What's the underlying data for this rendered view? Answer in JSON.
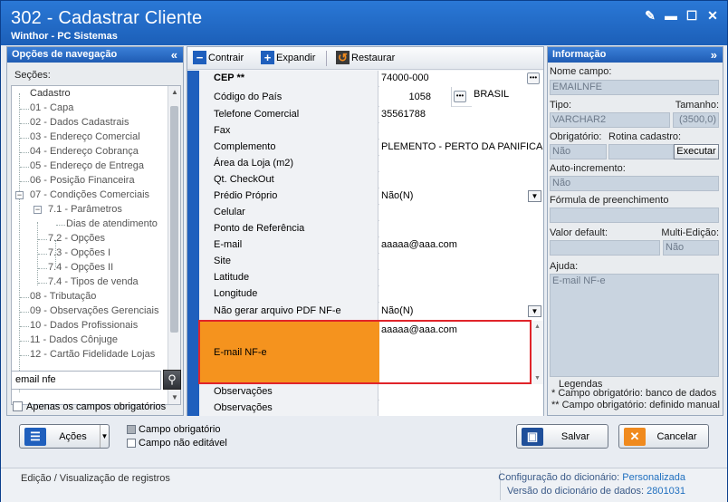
{
  "window": {
    "title": "302 - Cadastrar Cliente",
    "subtitle": "Winthor - PC Sistemas"
  },
  "nav": {
    "header": "Opções de navegação",
    "sections_label": "Seções:",
    "items": [
      {
        "label": "Cadastro"
      },
      {
        "label": "01 - Capa"
      },
      {
        "label": "02 - Dados Cadastrais"
      },
      {
        "label": "03 - Endereço Comercial"
      },
      {
        "label": "04 - Endereço Cobrança"
      },
      {
        "label": "05 - Endereço de Entrega"
      },
      {
        "label": "06 - Posição Financeira"
      },
      {
        "label": "07 - Condições Comerciais"
      },
      {
        "label": "7.1 - Parâmetros"
      },
      {
        "label": "Dias de atendimento"
      },
      {
        "label": "7.2 - Opções"
      },
      {
        "label": "7.3 - Opções I"
      },
      {
        "label": "7.4 - Opções II"
      },
      {
        "label": "7.4 - Tipos de venda"
      },
      {
        "label": "08 - Tributação"
      },
      {
        "label": "09 - Observações Gerenciais"
      },
      {
        "label": "10 - Dados Profissionais"
      },
      {
        "label": "11 - Dados Cônjuge"
      },
      {
        "label": "12 - Cartão Fidelidade Lojas"
      }
    ],
    "search_value": "email nfe",
    "only_required_label": "Apenas os campos obrigatórios"
  },
  "toolbar": {
    "collapse_label": "Contrair",
    "expand_label": "Expandir",
    "restore_label": "Restaurar"
  },
  "fields": [
    {
      "label": "CEP **",
      "value": "74000-000"
    },
    {
      "label": "Código do País",
      "value": "1058",
      "extra": "BRASIL"
    },
    {
      "label": "Telefone Comercial",
      "value": "35561788"
    },
    {
      "label": "Fax",
      "value": ""
    },
    {
      "label": "Complemento",
      "value": "PLEMENTO - PERTO DA PANIFICAI"
    },
    {
      "label": "Área da Loja (m2)",
      "value": ""
    },
    {
      "label": "Qt. CheckOut",
      "value": ""
    },
    {
      "label": "Prédio Próprio",
      "value": "Não(N)"
    },
    {
      "label": "Celular",
      "value": ""
    },
    {
      "label": "Ponto de Referência",
      "value": ""
    },
    {
      "label": "E-mail",
      "value": "aaaaa@aaa.com"
    },
    {
      "label": "Site",
      "value": ""
    },
    {
      "label": "Latitude",
      "value": ""
    },
    {
      "label": "Longitude",
      "value": ""
    },
    {
      "label": "Não gerar arquivo PDF NF-e",
      "value": "Não(N)"
    }
  ],
  "email_nfe": {
    "label": "E-mail NF-e",
    "value": "aaaaa@aaa.com"
  },
  "fields_after": [
    {
      "label": "Observações",
      "value": ""
    },
    {
      "label": "Observações",
      "value": ""
    }
  ],
  "info": {
    "header": "Informação",
    "field_name_label": "Nome campo:",
    "field_name": "EMAILNFE",
    "type_label": "Tipo:",
    "type": "VARCHAR2",
    "size_label": "Tamanho:",
    "size": "(3500,0)",
    "required_label": "Obrigatório:",
    "required": "Não",
    "routine_label": "Rotina cadastro:",
    "execute_label": "Executar",
    "autoinc_label": "Auto-incremento:",
    "autoinc": "Não",
    "formula_label": "Fórmula de preenchimento",
    "default_label": "Valor default:",
    "multiedit_label": "Multi-Edição:",
    "multiedit": "Não",
    "help_label": "Ajuda:",
    "help": "E-mail NF-e",
    "legend_title": "Legendas",
    "legend1": "* Campo obrigatório: banco de dados",
    "legend2": "** Campo obrigatório: definido manual"
  },
  "bottom": {
    "actions_label": "Ações",
    "legend_required": "Campo obrigatório",
    "legend_noedit": "Campo não editável",
    "save_label": "Salvar",
    "cancel_label": "Cancelar"
  },
  "status": {
    "mode": "Edição / Visualização de registros",
    "dict_config_label": "Configuração do dicionário:",
    "dict_config": "Personalizada",
    "dict_version_label": "Versão do dicionário de dados:",
    "dict_version": "2801031"
  },
  "colors": {
    "accent": "#1f5fbd",
    "highlight": "#f5931e",
    "selection_border": "#e0242a"
  }
}
